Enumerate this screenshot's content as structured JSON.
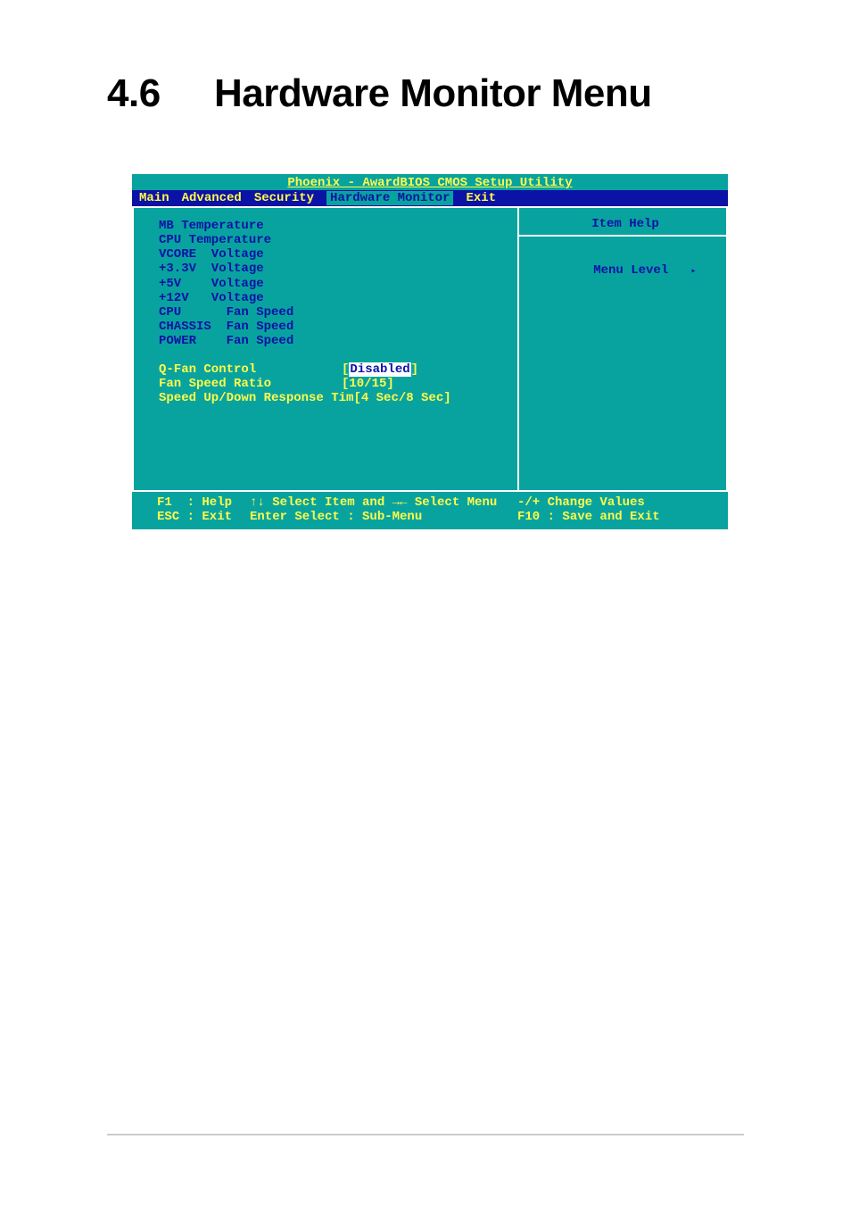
{
  "heading": {
    "number": "4.6",
    "title": "Hardware Monitor Menu"
  },
  "bios": {
    "title": "Phoenix - AwardBIOS CMOS Setup Utility",
    "tabs": [
      "Main",
      "Advanced",
      "Security",
      "Hardware Monitor",
      "Exit"
    ],
    "active_tab": "Hardware Monitor",
    "readonly_items": [
      "MB Temperature",
      "CPU Temperature",
      "VCORE  Voltage",
      "+3.3V  Voltage",
      "+5V    Voltage",
      "+12V   Voltage",
      "CPU      Fan Speed",
      "CHASSIS  Fan Speed",
      "POWER    Fan Speed"
    ],
    "settings": [
      {
        "label": "Q-Fan Control",
        "value": "Disabled",
        "selected": true
      },
      {
        "label": "Fan Speed Ratio",
        "value": "10/15",
        "selected": false
      },
      {
        "label": "Speed Up/Down Response Tim",
        "value": "4 Sec/8 Sec",
        "selected": false,
        "tight": true
      }
    ],
    "help": {
      "title": "Item Help",
      "menu_level_label": "Menu Level",
      "menu_level_arrow": "▸"
    },
    "footer": {
      "f1": "F1  : Help",
      "nav": "↑↓ Select Item and →← Select Menu",
      "change": "-/+ Change Values",
      "esc": "ESC : Exit",
      "enter": "Enter Select : Sub-Menu",
      "save": "F10 : Save and Exit"
    }
  }
}
